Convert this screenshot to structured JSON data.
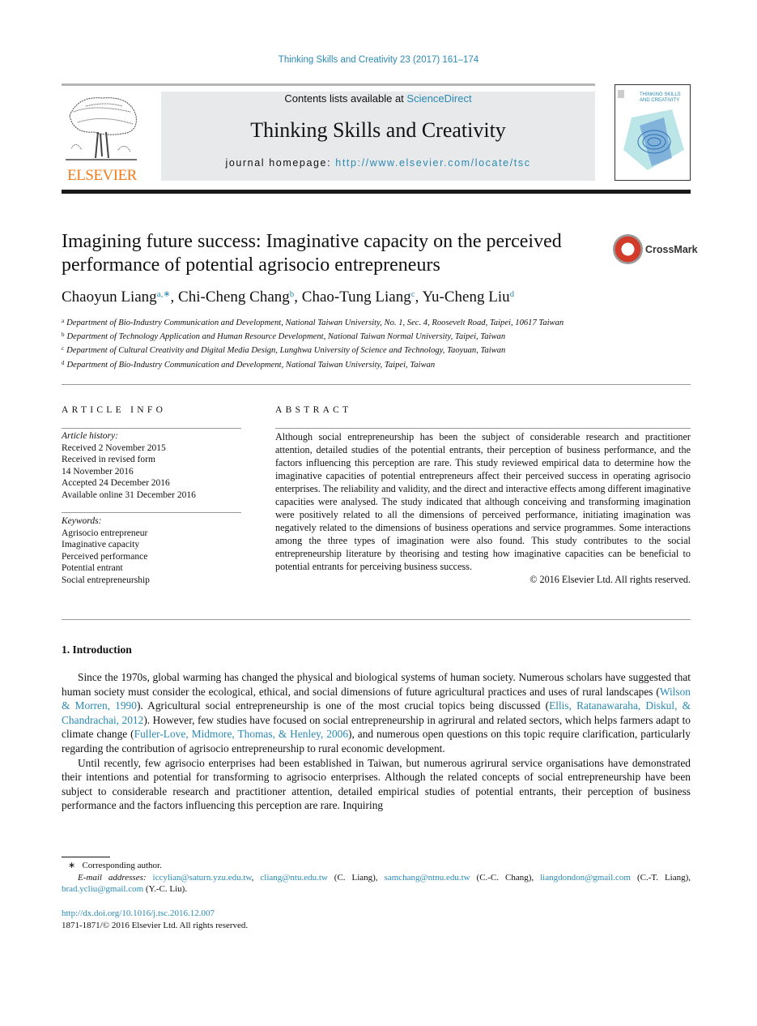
{
  "header": {
    "journal_reference": "Thinking Skills and Creativity 23 (2017) 161–174",
    "contents_prefix": "Contents lists available at ",
    "sciencedirect": "ScienceDirect",
    "journal_title": "Thinking Skills and Creativity",
    "homepage_prefix": "journal homepage: ",
    "homepage_url": "http://www.elsevier.com/locate/tsc",
    "publisher_logo": "ELSEVIER",
    "cover_title": "THINKING SKILLS AND CREATIVITY",
    "crossmark": "CrossMark"
  },
  "article": {
    "title": "Imagining future success: Imaginative capacity on the perceived performance of potential agrisocio entrepreneurs",
    "authors": [
      {
        "name": "Chaoyun Liang",
        "sup": "a,∗",
        "sep": ", "
      },
      {
        "name": "Chi-Cheng Chang",
        "sup": "b",
        "sep": ", "
      },
      {
        "name": "Chao-Tung Liang",
        "sup": "c",
        "sep": ", "
      },
      {
        "name": "Yu-Cheng Liu",
        "sup": "d",
        "sep": ""
      }
    ],
    "affiliations": [
      {
        "mark": "a",
        "text": "Department of Bio-Industry Communication and Development, National Taiwan University, No. 1, Sec. 4, Roosevelt Road, Taipei, 10617 Taiwan"
      },
      {
        "mark": "b",
        "text": "Department of Technology Application and Human Resource Development, National Taiwan Normal University, Taipei, Taiwan"
      },
      {
        "mark": "c",
        "text": "Department of Cultural Creativity and Digital Media Design, Lunghwa University of Science and Technology, Taoyuan, Taiwan"
      },
      {
        "mark": "d",
        "text": "Department of Bio-Industry Communication and Development, National Taiwan University, Taipei, Taiwan"
      }
    ]
  },
  "article_info": {
    "heading": "ARTICLE INFO",
    "history_label": "Article history:",
    "history": [
      "Received 2 November 2015",
      "Received in revised form",
      "14 November 2016",
      "Accepted 24 December 2016",
      "Available online 31 December 2016"
    ],
    "keywords_label": "Keywords:",
    "keywords": [
      "Agrisocio entrepreneur",
      "Imaginative capacity",
      "Perceived performance",
      "Potential entrant",
      "Social entrepreneurship"
    ]
  },
  "abstract": {
    "heading": "ABSTRACT",
    "text": "Although social entrepreneurship has been the subject of considerable research and practi­tioner attention, detailed studies of the potential entrants, their perception of business performance, and the factors influencing this perception are rare. This study reviewed empirical data to determine how the imaginative capacities of potential entrepreneurs affect their perceived success in operating agrisocio enterprises. The reliability and validity, and the direct and interactive effects among different imaginative capacities were ana­lysed. The study indicated that although conceiving and transforming imagination were positively related to all the dimensions of perceived performance, initiating imagination was negatively related to the dimensions of business operations and service programmes. Some interactions among the three types of imagination were also found. This study con­tributes to the social entrepreneurship literature by theorising and testing how imaginative capacities can be beneficial to potential entrants for perceiving business success.",
    "copyright": "© 2016 Elsevier Ltd. All rights reserved."
  },
  "introduction": {
    "heading": "1.  Introduction",
    "paragraphs": [
      [
        {
          "t": "Since the 1970s, global warming has changed the physical and biological systems of human society. Numerous scholars have suggested that human society must consider the ecological, ethical, and social dimensions of future agricultural prac­tices and uses of rural landscapes ("
        },
        {
          "t": "Wilson & Morren, 1990",
          "link": true
        },
        {
          "t": "). Agricultural social entrepreneurship is one of the most crucial topics being discussed ("
        },
        {
          "t": "Ellis, Ratanawaraha, Diskul, & Chandrachai, 2012",
          "link": true
        },
        {
          "t": "). However, few studies have focused on social entrepreneurship in agrirural and related sectors, which helps farmers adapt to climate change ("
        },
        {
          "t": "Fuller-Love, Midmore, Thomas, & Henley, 2006",
          "link": true
        },
        {
          "t": "), and numerous open questions on this topic require clarification, particularly regarding the contribution of agrisocio entrepreneurship to rural economic development."
        }
      ],
      [
        {
          "t": "Until recently, few agrisocio enterprises had been established in Taiwan, but numerous agrirural service organisations have demonstrated their intentions and potential for transforming to agrisocio enterprises. Although the related concepts of social entrepreneurship have been subject to considerable research and practitioner attention, detailed empirical studies of potential entrants, their perception of business performance and the factors influencing this perception are rare. Inquiring"
        }
      ]
    ]
  },
  "footnotes": {
    "corresponding": "Corresponding author.",
    "corresponding_mark": "∗",
    "email_label": "E-mail addresses:",
    "emails": [
      {
        "t": "iccylian@saturn.yzu.edu.tw",
        "link": true
      },
      {
        "t": ", "
      },
      {
        "t": "cliang@ntu.edu.tw",
        "link": true
      },
      {
        "t": " (C. Liang), "
      },
      {
        "t": "samchang@ntnu.edu.tw",
        "link": true
      },
      {
        "t": " (C.-C. Chang), "
      },
      {
        "t": "liangdondon@gmail.com",
        "link": true
      },
      {
        "t": " (C.-T. Liang), "
      },
      {
        "t": "brad.ycliu@gmail.com",
        "link": true
      },
      {
        "t": " (Y.-C. Liu)."
      }
    ],
    "doi": "http://dx.doi.org/10.1016/j.tsc.2016.12.007",
    "issn_copyright": "1871-1871/© 2016 Elsevier Ltd. All rights reserved."
  },
  "colors": {
    "link": "#2a8ab5",
    "elsevier_orange": "#f07c1e",
    "header_box": "#e8e9ea"
  }
}
